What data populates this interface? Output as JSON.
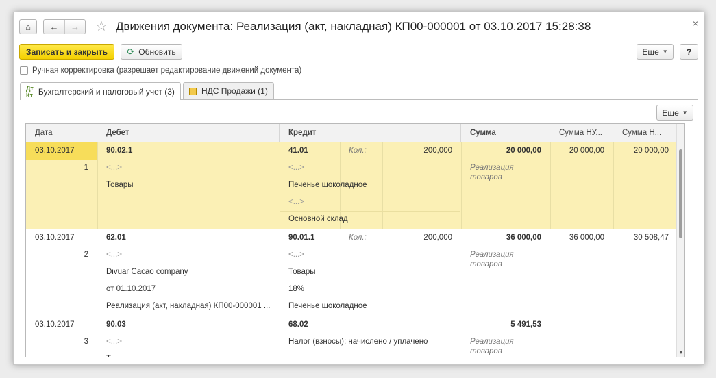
{
  "window": {
    "title": "Движения документа: Реализация (акт, накладная) КП00-000001 от 03.10.2017 15:28:38",
    "close": "×"
  },
  "toolbar": {
    "save_close": "Записать и закрыть",
    "refresh": "Обновить",
    "more": "Еще",
    "help": "?"
  },
  "manual_correction": {
    "label": "Ручная корректировка (разрешает редактирование движений документа)",
    "checked": false
  },
  "tabs": [
    {
      "label": "Бухгалтерский и налоговый учет (3)",
      "icon": "ledger-icon",
      "active": true
    },
    {
      "label": "НДС Продажи (1)",
      "icon": "vat-register-icon",
      "active": false
    }
  ],
  "grid": {
    "more": "Еще",
    "columns": {
      "date": "Дата",
      "debit": "Дебет",
      "credit": "Кредит",
      "amount": "Сумма",
      "amount_nu": "Сумма НУ...",
      "amount_n": "Сумма Н..."
    },
    "records": [
      {
        "date": "03.10.2017",
        "num": "1",
        "debit": [
          "90.02.1",
          "<...>",
          "Товары"
        ],
        "credit": [
          "41.01",
          "<...>",
          "Печенье шоколадное",
          "<...>",
          "Основной склад"
        ],
        "qty_label": "Кол.:",
        "qty": "200,000",
        "amount": "20 000,00",
        "content": "Реализация товаров",
        "amount_nu": "20 000,00",
        "amount_n": "20 000,00"
      },
      {
        "date": "03.10.2017",
        "num": "2",
        "debit": [
          "62.01",
          "<...>",
          "Divuar Cacao company",
          "от 01.10.2017",
          "Реализация (акт, накладная) КП00-000001 ..."
        ],
        "credit": [
          "90.01.1",
          "<...>",
          "Товары",
          "18%",
          "Печенье шоколадное"
        ],
        "qty_label": "Кол.:",
        "qty": "200,000",
        "amount": "36 000,00",
        "content": "Реализация товаров",
        "amount_nu": "36 000,00",
        "amount_n": "30 508,47"
      },
      {
        "date": "03.10.2017",
        "num": "3",
        "debit": [
          "90.03",
          "<...>",
          "Т"
        ],
        "credit": [
          "68.02",
          "Налог (взносы): начислено / уплачено"
        ],
        "amount": "5 491,53",
        "content": "Реализация товаров"
      }
    ]
  }
}
